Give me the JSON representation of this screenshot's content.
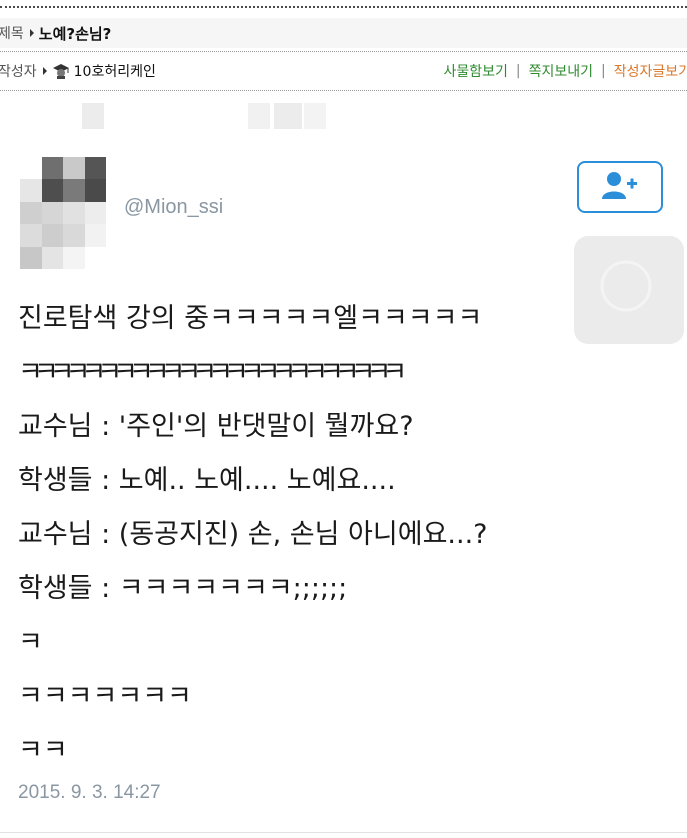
{
  "board": {
    "title_label": "제목",
    "title_value": "노예?손님?",
    "author_label": "작성자",
    "author_name": "10호허리케인",
    "links": [
      "사물함보기",
      "쪽지보내기",
      "작성자글보기"
    ],
    "link_separator": "|",
    "link_colors": [
      "#2f8b2f",
      "#2f8b2f",
      "#d9772a"
    ]
  },
  "tweet": {
    "handle": "@Mion_ssi",
    "avatar_icon": "blurred-avatar",
    "follow_icon": "add-user-icon",
    "lines": [
      "진로탐색 강의 중ㅋㅋㅋㅋㅋ엘ㅋㅋㅋㅋㅋ",
      "ㅋㅋㅋㅋㅋㅋㅋㅋㅋㅋㅋㅋㅋㅋㅋㅋㅋㅋㅋㅋㅋㅋㅋㅋ",
      "교수님 : '주인'의 반댓말이 뭘까요?",
      "학생들 : 노예.. 노예....  노예요....",
      "교수님 : (동공지진) 손, 손님 아니에요...?",
      "학생들 : ㅋㅋㅋㅋㅋㅋㅋ;;;;;;",
      "ㅋ",
      "ㅋㅋㅋㅋㅋㅋㅋ",
      "ㅋㅋ"
    ],
    "timestamp": "2015. 9. 3. 14:27",
    "accent_color": "#2b8ed9"
  }
}
